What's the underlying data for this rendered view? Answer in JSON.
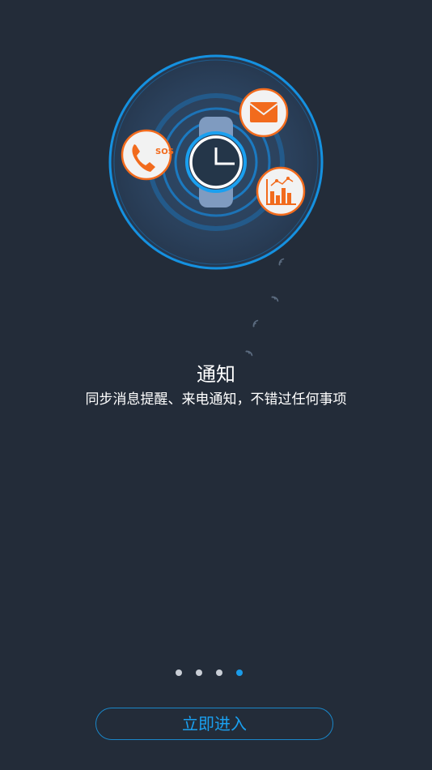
{
  "page": {
    "title": "通知",
    "subtitle": "同步消息提醒、来电通知，不错过任何事项",
    "enter_button_label": "立即进入"
  },
  "pager": {
    "total": 4,
    "active_index": 3
  },
  "illustration": {
    "icons": [
      "watch-clock-icon",
      "sos-phone-icon",
      "mail-icon",
      "chart-icon",
      "signal-icon"
    ],
    "sos_text": "SOS"
  },
  "colors": {
    "background": "#232c39",
    "accent_blue": "#1a9be8",
    "icon_orange": "#f26b1d"
  }
}
